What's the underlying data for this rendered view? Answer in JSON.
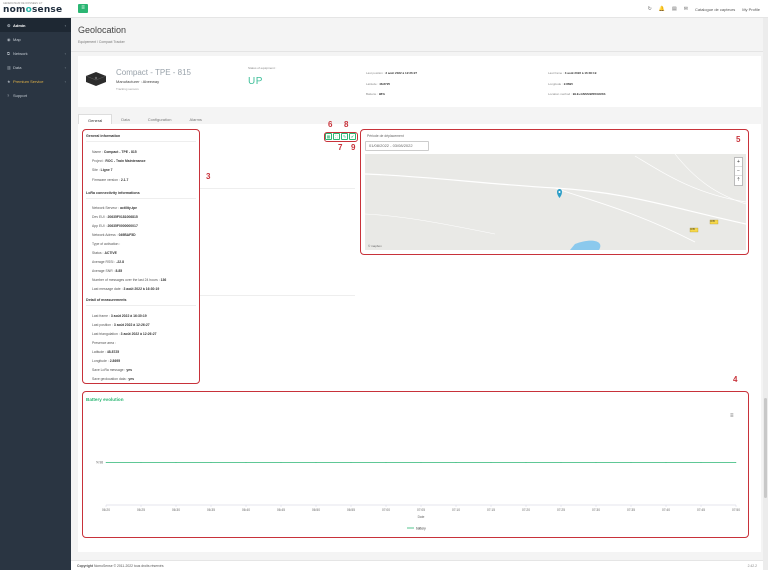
{
  "brand": {
    "tag": "GENERATEUR DE DONNEES IoT",
    "name_pre": "nom",
    "name_o": "o",
    "name_post": "sense"
  },
  "topbar": {
    "menu_glyph": "≡",
    "icons": [
      {
        "name": "refresh-icon",
        "glyph": "↻"
      },
      {
        "name": "bell-icon",
        "glyph": "🔔"
      },
      {
        "name": "trash-icon",
        "glyph": "▤"
      },
      {
        "name": "chat-icon",
        "glyph": "✉"
      }
    ],
    "catalogue_label": "Catalogue de capteurs",
    "profile_label": "My Profile"
  },
  "sidebar": {
    "items": [
      {
        "label": "Admin",
        "icon": "⚙",
        "active": true,
        "chev": "‹"
      },
      {
        "label": "Map",
        "icon": "◉",
        "chev": ""
      },
      {
        "label": "Network",
        "icon": "⧉",
        "chev": "‹"
      },
      {
        "label": "Data",
        "icon": "▥",
        "chev": "‹"
      },
      {
        "label": "Premium Service",
        "icon": "★",
        "premium": true,
        "chev": "‹"
      },
      {
        "label": "Support",
        "icon": "?",
        "chev": ""
      }
    ]
  },
  "header": {
    "title": "Geolocation",
    "breadcrumb": "Equipement  /  Compact Tracker"
  },
  "equipment": {
    "name": "Compact - TPE - 815",
    "manufacturer": "Manufacturer : Abeeway",
    "type": "Tracking sensors",
    "status_label": "Status of equipment :",
    "status_value": "UP",
    "last_position_label": "Last position :",
    "last_position": "3 août 2022 à 12:26:27",
    "latitude_label": "Latitude :",
    "latitude": "48.8725",
    "battery_label": "Batterie :",
    "battery": "98%",
    "last_frame_label": "Last frame :",
    "last_frame": "3 août 2022 à 16:30:19",
    "longitude_label": "Longitude :",
    "longitude": "2.8695",
    "loc_method_label": "Location method :",
    "loc_method": "BLE+GNSS/WIFI/GNSS"
  },
  "tabs": [
    "General",
    "Data",
    "Configuration",
    "Alarms"
  ],
  "general_info": {
    "title": "General information",
    "lines": [
      {
        "k": "Name : ",
        "v": "Compact - TPE - 815"
      },
      {
        "k": "Project : ",
        "v": "ROC - Train Maintenance"
      },
      {
        "k": "Site : ",
        "v": "Ligne 7"
      },
      {
        "k": "Firmware version : ",
        "v": "2.1.7"
      }
    ]
  },
  "lora_info": {
    "title": "LoRa connectivity informations",
    "lines": [
      {
        "k": "Network Serveur : ",
        "v": "actility-tpe"
      },
      {
        "k": "Dev EUI : ",
        "v": "20635F0181006815"
      },
      {
        "k": "App EUI : ",
        "v": "20635F0000000017"
      },
      {
        "k": "Network Adress : ",
        "v": "049BAF5D"
      },
      {
        "k": "Type of activation : ",
        "v": ""
      },
      {
        "k": "Status : ",
        "v": "ACTIVE"
      },
      {
        "k": "Average RSSI : ",
        "v": "-22.8"
      },
      {
        "k": "Average SNR : ",
        "v": "8.85"
      },
      {
        "k": "Number of messages over the last 24 hours : ",
        "v": "136"
      },
      {
        "k": "Last message date : ",
        "v": "3 août 2022 à 16:30:19"
      }
    ]
  },
  "measure_info": {
    "title": "Detail of measurements",
    "lines": [
      {
        "k": "Last frame : ",
        "v": "3 août 2022 à 16:30:19"
      },
      {
        "k": "Last position : ",
        "v": "3 août 2022 à 12:26:27"
      },
      {
        "k": "Last triangulation : ",
        "v": "3 août 2022 à 12:26:27"
      },
      {
        "k": "Presence area : ",
        "v": ""
      },
      {
        "k": "Latitude : ",
        "v": "48.8725"
      },
      {
        "k": "Longitude : ",
        "v": "2.8695"
      },
      {
        "k": "Save LoRa message : ",
        "v": "yes"
      },
      {
        "k": "Save geolocation data : ",
        "v": "yes"
      }
    ]
  },
  "actions": [
    {
      "name": "action-6-button",
      "glyph": "▦"
    },
    {
      "name": "action-7-button",
      "glyph": "⛶"
    },
    {
      "name": "action-8-button",
      "glyph": "✎"
    },
    {
      "name": "action-9-button",
      "glyph": "✔"
    }
  ],
  "period": {
    "label": "Période de déplacement",
    "value": "01/08/2022 - 03/08/2022"
  },
  "map": {
    "zoom_in": "+",
    "zoom_out": "−",
    "compass": "⇡",
    "credit": "© mapbox",
    "road_labels": [
      "D35",
      "D35"
    ]
  },
  "annotations": [
    "3",
    "4",
    "5",
    "6",
    "7",
    "8",
    "9"
  ],
  "colors": {
    "accent": "#2bb673",
    "status_up": "#3fbf9a",
    "annotation": "#c8323a",
    "sidebar": "#2a3542"
  },
  "chart_data": {
    "type": "line",
    "title": "Battery evolution",
    "xlabel": "Date",
    "ylabel": "%",
    "x": [
      "06:20",
      "06:25",
      "06:30",
      "06:35",
      "06:40",
      "06:45",
      "06:50",
      "06:55",
      "07:00",
      "07:05",
      "07:10",
      "07:15",
      "07:20",
      "07:25",
      "07:30",
      "07:35",
      "07:40",
      "07:45",
      "07:50"
    ],
    "series": [
      {
        "name": "battery",
        "values": [
          98,
          98,
          98,
          98,
          98,
          98,
          98,
          98,
          98,
          98,
          98,
          98,
          98,
          98,
          98,
          98,
          98,
          98,
          98
        ]
      }
    ],
    "yticks": [
      "98"
    ],
    "legend": "bottom"
  },
  "footer": {
    "copyright": "Copyright",
    "brand": "NomoSense",
    "text": " © 2011-2022 tous droits réservés",
    "version": "2.42.2"
  }
}
